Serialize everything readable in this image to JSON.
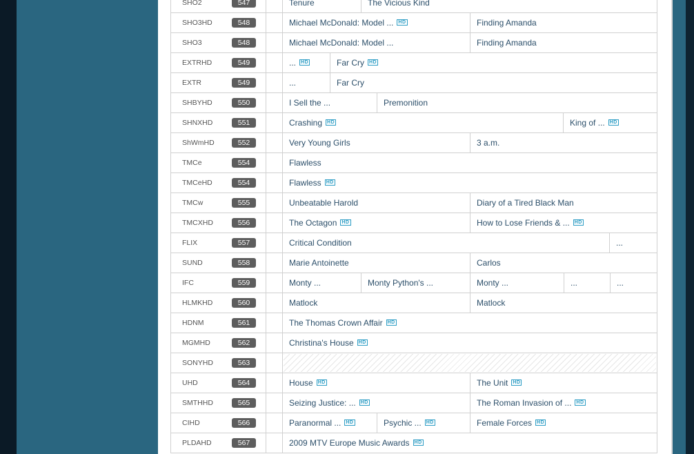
{
  "hd_badge": "HD",
  "rows": [
    {
      "name": "SHO2",
      "num": "547",
      "programs": [
        {
          "title": "Tenure",
          "hd": false
        },
        {
          "title": "The Vicious Kind",
          "hd": false
        }
      ]
    },
    {
      "name": "SHO3HD",
      "num": "548",
      "programs": [
        {
          "title": "Michael McDonald: Model ...",
          "hd": true
        },
        {
          "title": "Finding Amanda",
          "hd": false
        }
      ]
    },
    {
      "name": "SHO3",
      "num": "548",
      "programs": [
        {
          "title": "Michael McDonald: Model ...",
          "hd": false
        },
        {
          "title": "Finding Amanda",
          "hd": false
        }
      ]
    },
    {
      "name": "EXTRHD",
      "num": "549",
      "programs": [
        {
          "title": "...",
          "hd": true
        },
        {
          "title": "Far Cry",
          "hd": true
        }
      ]
    },
    {
      "name": "EXTR",
      "num": "549",
      "programs": [
        {
          "title": "...",
          "hd": false
        },
        {
          "title": "Far Cry",
          "hd": false
        }
      ]
    },
    {
      "name": "SHBYHD",
      "num": "550",
      "programs": [
        {
          "title": "I Sell the ...",
          "hd": false
        },
        {
          "title": "Premonition",
          "hd": false
        }
      ]
    },
    {
      "name": "SHNXHD",
      "num": "551",
      "programs": [
        {
          "title": "Crashing",
          "hd": true
        },
        {
          "title": "King of ...",
          "hd": true
        }
      ]
    },
    {
      "name": "ShWmHD",
      "num": "552",
      "programs": [
        {
          "title": "Very Young Girls",
          "hd": false
        },
        {
          "title": "3 a.m.",
          "hd": false
        }
      ]
    },
    {
      "name": "TMCe",
      "num": "554",
      "programs": [
        {
          "title": "Flawless",
          "hd": false
        }
      ]
    },
    {
      "name": "TMCeHD",
      "num": "554",
      "programs": [
        {
          "title": "Flawless",
          "hd": true
        }
      ]
    },
    {
      "name": "TMCw",
      "num": "555",
      "programs": [
        {
          "title": "Unbeatable Harold",
          "hd": false
        },
        {
          "title": "Diary of a Tired Black Man",
          "hd": false
        }
      ]
    },
    {
      "name": "TMCXHD",
      "num": "556",
      "programs": [
        {
          "title": "The Octagon",
          "hd": true
        },
        {
          "title": "How to Lose Friends & ...",
          "hd": true
        }
      ]
    },
    {
      "name": "FLIX",
      "num": "557",
      "programs": [
        {
          "title": "Critical Condition",
          "hd": false
        },
        {
          "title": "...",
          "hd": false
        }
      ]
    },
    {
      "name": "SUND",
      "num": "558",
      "programs": [
        {
          "title": "Marie Antoinette",
          "hd": false
        },
        {
          "title": "Carlos",
          "hd": false
        }
      ]
    },
    {
      "name": "IFC",
      "num": "559",
      "programs": [
        {
          "title": "Monty ...",
          "hd": false
        },
        {
          "title": "Monty Python's ...",
          "hd": false
        },
        {
          "title": "Monty ...",
          "hd": false
        },
        {
          "title": "...",
          "hd": false
        },
        {
          "title": "...",
          "hd": false
        }
      ]
    },
    {
      "name": "HLMKHD",
      "num": "560",
      "programs": [
        {
          "title": "Matlock",
          "hd": false
        },
        {
          "title": "Matlock",
          "hd": false
        }
      ]
    },
    {
      "name": "HDNM",
      "num": "561",
      "programs": [
        {
          "title": "The Thomas Crown Affair",
          "hd": true
        }
      ]
    },
    {
      "name": "MGMHD",
      "num": "562",
      "programs": [
        {
          "title": "Christina's House",
          "hd": true
        }
      ]
    },
    {
      "name": "SONYHD",
      "num": "563",
      "programs": []
    },
    {
      "name": "UHD",
      "num": "564",
      "programs": [
        {
          "title": "House",
          "hd": true
        },
        {
          "title": "The Unit",
          "hd": true
        }
      ]
    },
    {
      "name": "SMTHHD",
      "num": "565",
      "programs": [
        {
          "title": "Seizing Justice: ...",
          "hd": true
        },
        {
          "title": "The Roman Invasion of ...",
          "hd": true
        }
      ]
    },
    {
      "name": "CIHD",
      "num": "566",
      "programs": [
        {
          "title": "Paranormal ...",
          "hd": true
        },
        {
          "title": "Psychic ...",
          "hd": true
        },
        {
          "title": "Female Forces",
          "hd": true
        }
      ]
    },
    {
      "name": "PLDAHD",
      "num": "567",
      "programs": [
        {
          "title": "2009 MTV Europe Music Awards",
          "hd": true
        }
      ]
    }
  ]
}
